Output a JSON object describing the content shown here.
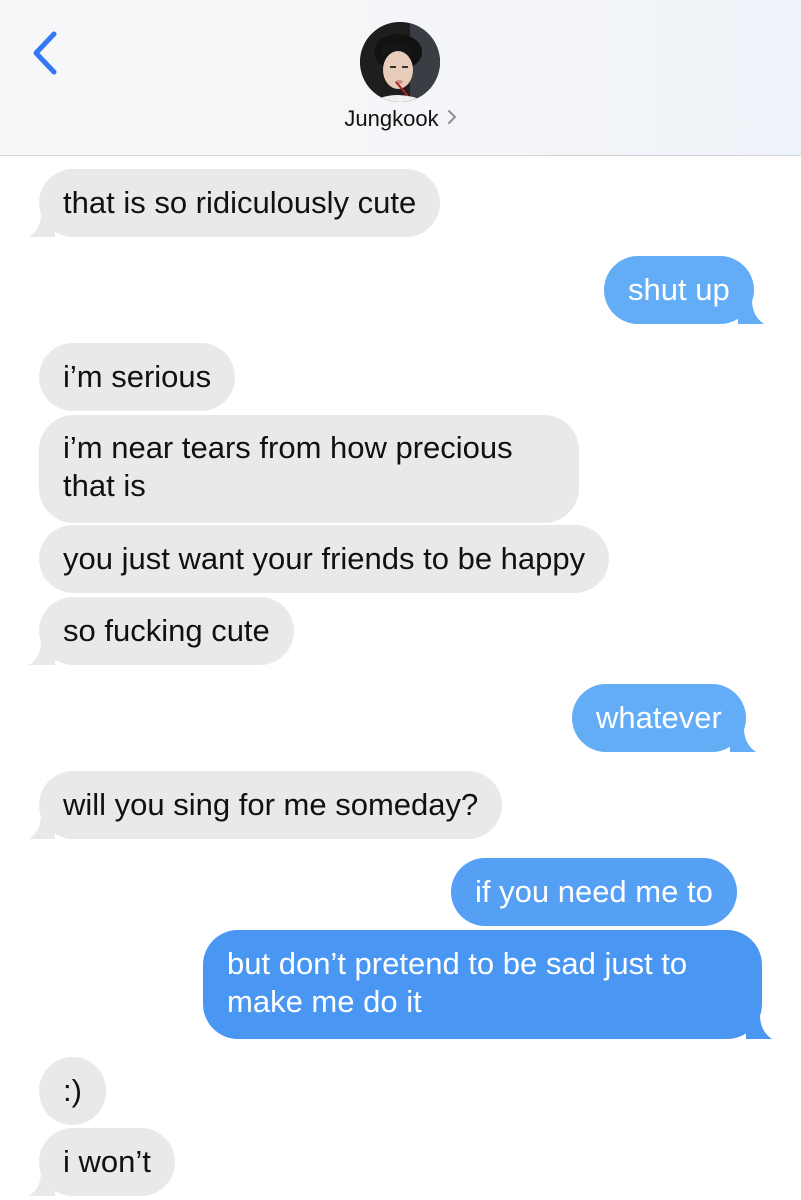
{
  "header": {
    "contact_name": "Jungkook",
    "back_icon": "chevron-left-icon",
    "disclosure_icon": "chevron-right-icon",
    "accent_color": "#3478f6"
  },
  "messages": [
    {
      "direction": "incoming",
      "text": "that is so ridiculously cute"
    },
    {
      "direction": "outgoing",
      "text": "shut up"
    },
    {
      "direction": "incoming",
      "text": "i’m serious"
    },
    {
      "direction": "incoming",
      "lines": [
        "i’m near tears from how precious",
        "that is"
      ]
    },
    {
      "direction": "incoming",
      "text": "you just want your friends to be happy"
    },
    {
      "direction": "incoming",
      "text": "so fucking cute"
    },
    {
      "direction": "outgoing",
      "text": "whatever"
    },
    {
      "direction": "incoming",
      "text": "will you sing for me someday?"
    },
    {
      "direction": "outgoing",
      "text": "if you need me to"
    },
    {
      "direction": "outgoing",
      "lines": [
        "but don’t pretend to be sad just to",
        "make me do it"
      ]
    },
    {
      "direction": "incoming",
      "text": ":)"
    },
    {
      "direction": "incoming",
      "text": "i won’t"
    }
  ],
  "colors": {
    "incoming_bubble": "#e9e9eb",
    "outgoing_bubble": "#4a97f3",
    "outgoing_bubble_light": "#63adf6"
  }
}
